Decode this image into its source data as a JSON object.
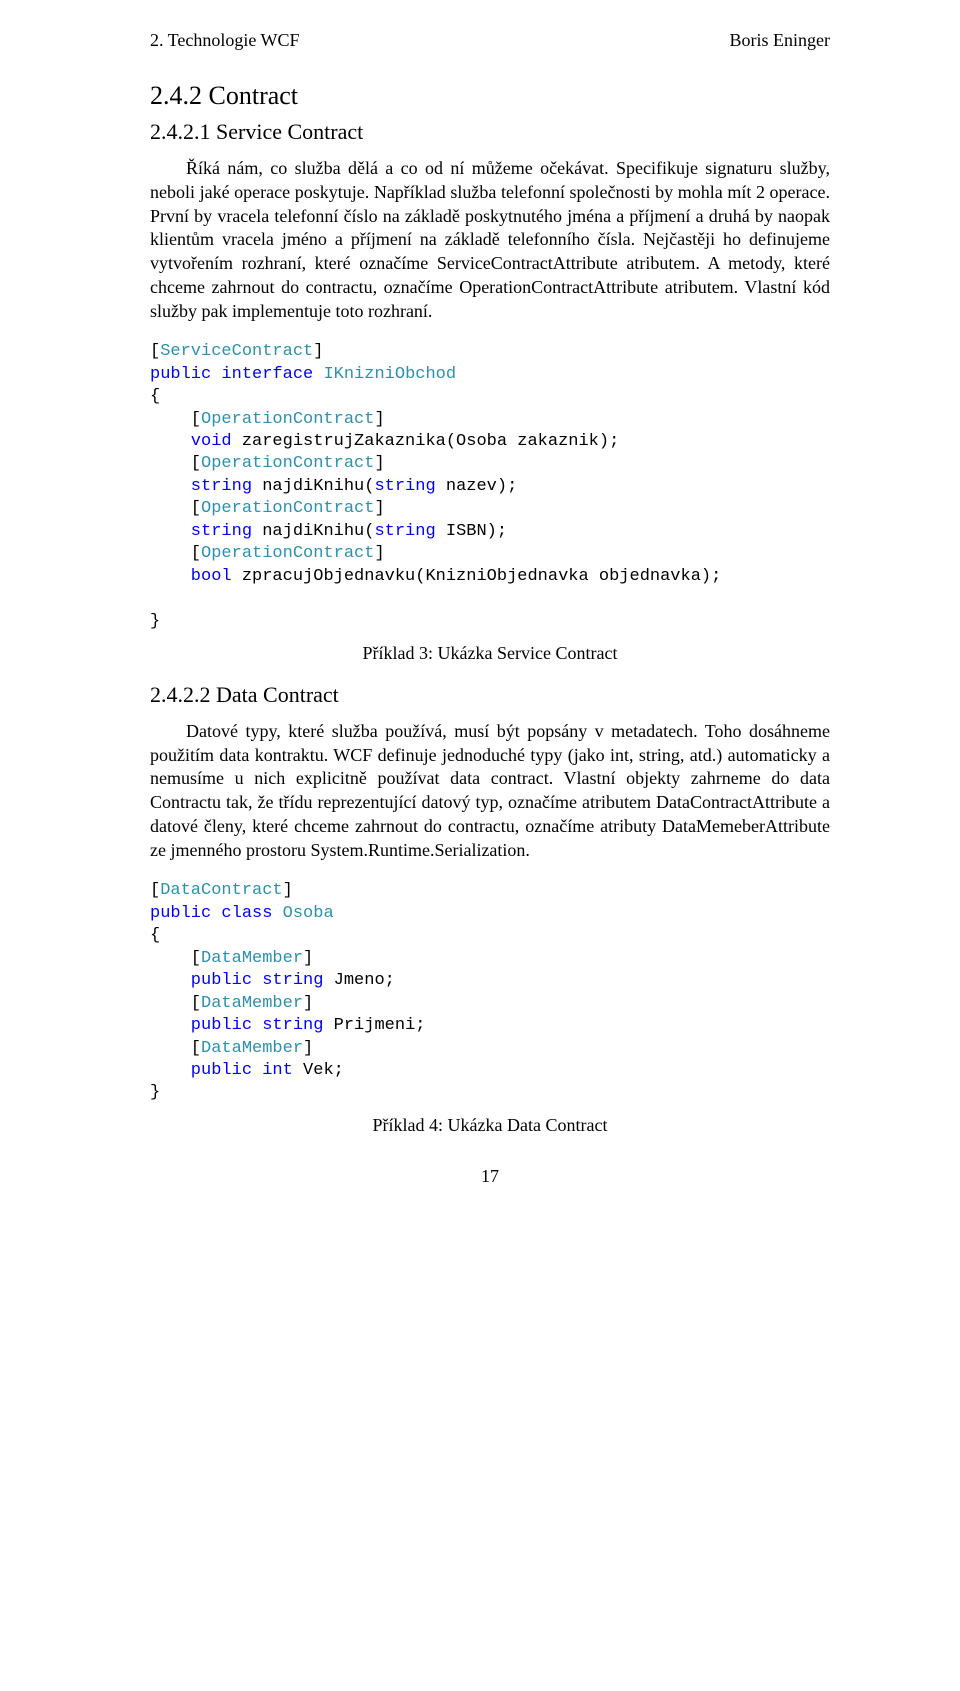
{
  "header": {
    "left": "2. Technologie WCF",
    "right": "Boris Eninger"
  },
  "section": {
    "title": "2.4.2  Contract"
  },
  "sub1": {
    "title": "2.4.2.1 Service Contract",
    "para": "Říká nám, co služba dělá a co od ní můžeme očekávat. Specifikuje signaturu služby, neboli jaké operace poskytuje. Například služba telefonní společnosti by mohla mít 2 operace. První by vracela telefonní číslo na základě poskytnutého jména a příjmení a druhá by naopak klientům vracela jméno a příjmení na základě telefonního čísla. Nejčastěji ho definujeme vytvořením rozhraní, které označíme ServiceContractAttribute atributem. A metody, které chceme zahrnout do contractu, označíme OperationContractAttribute atributem. Vlastní kód služby pak implementuje toto rozhraní."
  },
  "code1": {
    "t": {
      "sc_open": "[",
      "sc": "ServiceContract",
      "sc_close": "]",
      "public": "public",
      "interface": "interface",
      "iface": "IKnizniObchod",
      "lbrace": "{",
      "oc_open": "    [",
      "oc": "OperationContract",
      "oc_close": "]",
      "void": "    void",
      "m1": " zaregistrujZakaznika(Osoba zakaznik);",
      "string": "    string",
      "m2a": " najdiKnihu(",
      "stringkw": "string",
      "m2b": " nazev);",
      "m3b": " ISBN);",
      "bool": "    bool",
      "m4": " zpracujObjednavku(KnizniObjednavka objednavka);",
      "rbrace": "}"
    },
    "caption": "Příklad 3: Ukázka Service Contract"
  },
  "sub2": {
    "title": "2.4.2.2 Data Contract",
    "para": "Datové typy, které služba používá, musí být popsány v metadatech. Toho dosáhneme použitím data kontraktu. WCF definuje jednoduché typy (jako int, string, atd.) automaticky a nemusíme u nich explicitně používat data contract. Vlastní objekty zahrneme do data Contractu tak, že třídu reprezentující datový typ, označíme atributem DataContractAttribute a datové členy, které chceme zahrnout do contractu, označíme atributy DataMemeberAttribute ze jmenného prostoru System.Runtime.Serialization."
  },
  "code2": {
    "t": {
      "dc_open": "[",
      "dc": "DataContract",
      "dc_close": "]",
      "public": "public",
      "class": "class",
      "cls": "Osoba",
      "lbrace": "{",
      "dm_open": "    [",
      "dm": "DataMember",
      "dm_close": "]",
      "pub": "    public",
      "string": "string",
      "f1": " Jmeno;",
      "f2": " Prijmeni;",
      "int": "int",
      "f3": " Vek;",
      "rbrace": "}"
    },
    "caption": "Příklad 4: Ukázka Data Contract"
  },
  "pageNumber": "17"
}
